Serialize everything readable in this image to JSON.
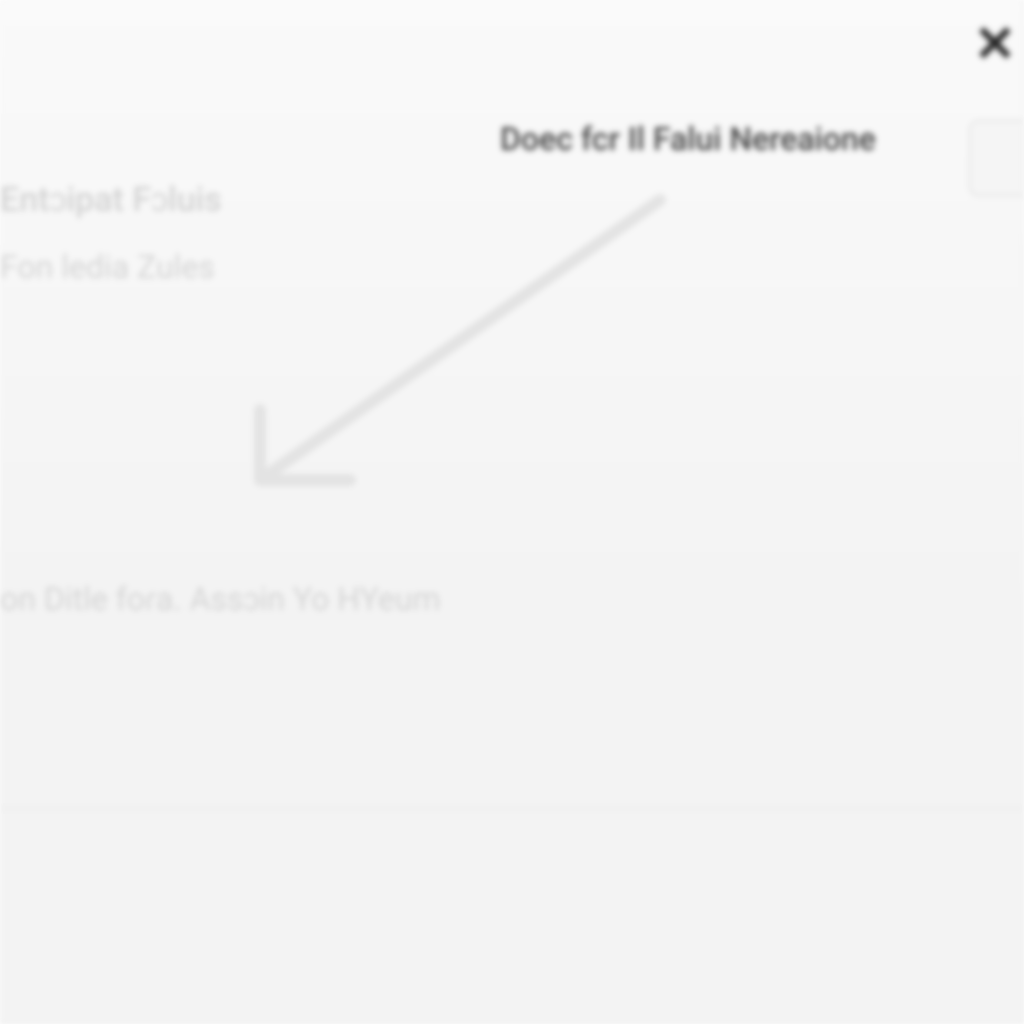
{
  "dialog": {
    "title": "Doec fcr Il Falui Nereaione",
    "close_label": "✕"
  },
  "content": {
    "line1": "Entɔipat Fɔluis",
    "line2": "Fon ledia Zules",
    "line3": "on Ditle foɾa. Assɔin Yo HYeum"
  }
}
